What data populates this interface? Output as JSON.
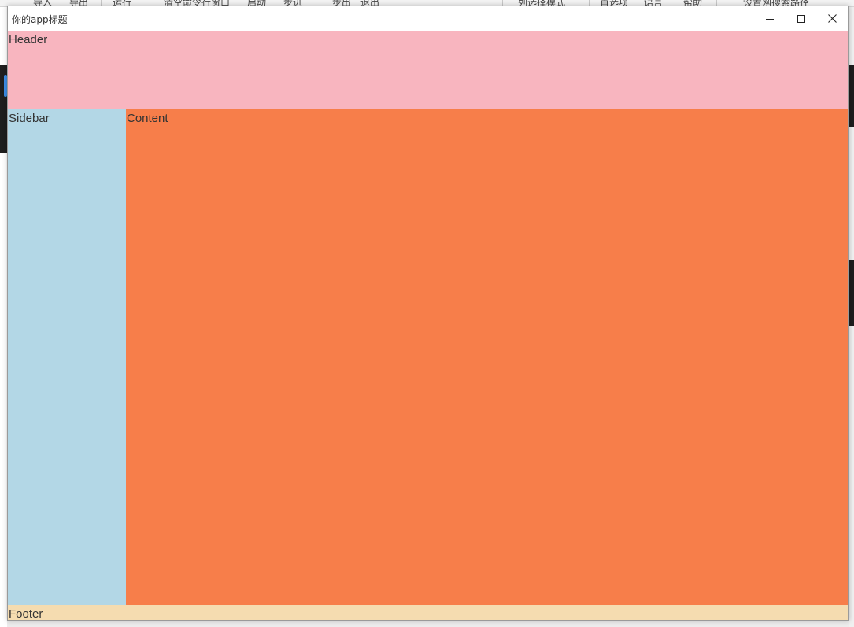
{
  "background_toolbar": {
    "items": [
      "导入",
      "导出",
      "运行",
      "清空命令行窗口",
      "启动",
      "步进",
      "步出",
      "退出",
      "列选择模式",
      "首选项",
      "语言",
      "帮助",
      "设置网搜索路径"
    ]
  },
  "window": {
    "title": "你的app标题",
    "controls": {
      "minimize_icon": "minimize-icon",
      "maximize_icon": "maximize-icon",
      "close_icon": "close-icon"
    }
  },
  "layout": {
    "header_label": "Header",
    "sidebar_label": "Sidebar",
    "content_label": "Content",
    "footer_label": "Footer"
  },
  "colors": {
    "header": "#f8b5bf",
    "sidebar": "#b3d7e6",
    "content": "#f77e4a",
    "footer": "#f5dcb0"
  }
}
